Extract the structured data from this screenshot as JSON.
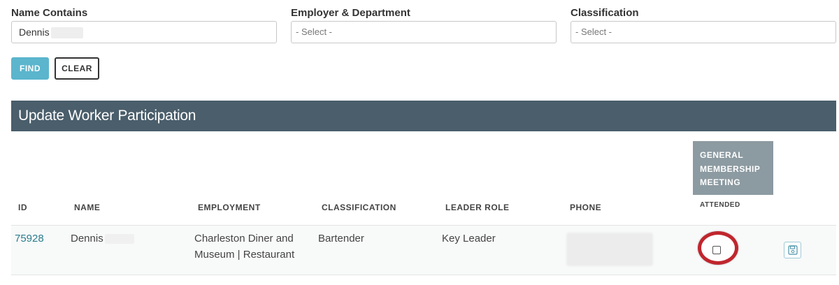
{
  "filters": {
    "name": {
      "label": "Name Contains",
      "value": "Dennis"
    },
    "employer": {
      "label": "Employer & Department",
      "placeholder": "- Select -"
    },
    "classification": {
      "label": "Classification",
      "placeholder": "- Select -"
    }
  },
  "buttons": {
    "find": "FIND",
    "clear": "CLEAR"
  },
  "panel": {
    "title": "Update Worker Participation"
  },
  "table": {
    "headers": {
      "id": "ID",
      "name": "NAME",
      "employment": "EMPLOYMENT",
      "classification": "CLASSIFICATION",
      "leader_role": "LEADER ROLE",
      "phone": "PHONE",
      "meeting_line1": "GENERAL",
      "meeting_line2": "MEMBERSHIP",
      "meeting_line3": "MEETING",
      "attended": "ATTENDED"
    },
    "rows": [
      {
        "id": "75928",
        "name": "Dennis",
        "employment_line1": "Charleston Diner and",
        "employment_line2": "Museum | Restaurant",
        "classification": "Bartender",
        "leader_role": "Key Leader",
        "attended": false
      }
    ]
  },
  "colors": {
    "accent": "#5bb5cd",
    "header_bg": "#4a5e6b",
    "meeting_bg": "#8c9aa1",
    "highlight_ring": "#c0262d",
    "link": "#2a7d8c"
  },
  "icons": {
    "save": "save-icon"
  }
}
